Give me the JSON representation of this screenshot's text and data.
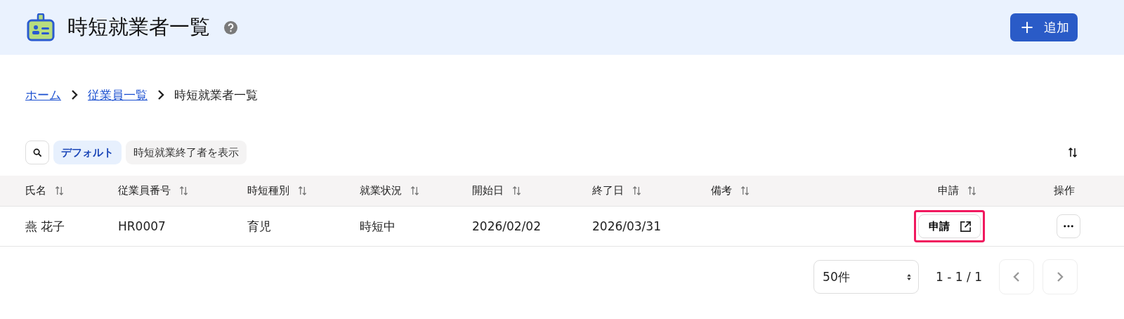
{
  "header": {
    "title": "時短就業者一覧",
    "add_button": {
      "icon": "+",
      "label": "追加"
    }
  },
  "breadcrumb": [
    {
      "label": "ホーム",
      "kind": "link"
    },
    {
      "label": "従業員一覧",
      "kind": "link"
    },
    {
      "label": "時短就業者一覧",
      "kind": "current"
    }
  ],
  "filters": [
    {
      "label": "デフォルト",
      "selected": true
    },
    {
      "label": "時短就業終了者を表示",
      "selected": false
    }
  ],
  "table": {
    "columns": [
      {
        "label": "氏名",
        "sortable": true
      },
      {
        "label": "従業員番号",
        "sortable": true
      },
      {
        "label": "時短種別",
        "sortable": true
      },
      {
        "label": "就業状況",
        "sortable": true
      },
      {
        "label": "開始日",
        "sortable": true
      },
      {
        "label": "終了日",
        "sortable": true
      },
      {
        "label": "備考",
        "sortable": true
      },
      {
        "label": "申請",
        "sortable": true
      },
      {
        "label": "操作",
        "sortable": false
      }
    ],
    "rows": [
      {
        "cells": [
          "燕 花子",
          "HR0007",
          "育児",
          "時短中",
          "2026/02/02",
          "2026/03/31",
          null
        ],
        "apply_button": {
          "label": "申請",
          "highlighted": true
        }
      }
    ]
  },
  "pagination": {
    "page_size": "50件",
    "range": "1 - 1 / 1"
  }
}
